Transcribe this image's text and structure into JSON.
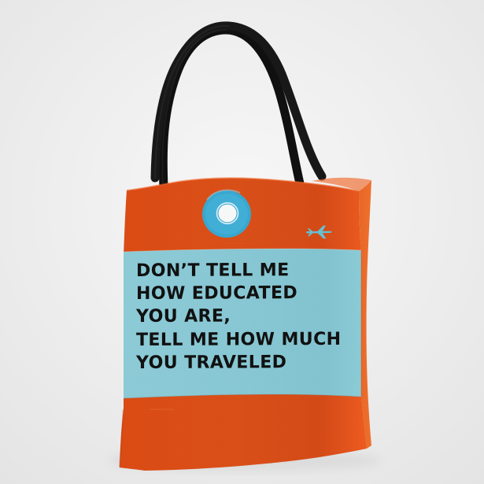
{
  "product": {
    "quote_lines": [
      "DON’T TELL ME",
      "HOW EDUCATED",
      "YOU ARE,",
      "TELL ME HOW MUCH",
      "YOU TRAVELED"
    ]
  },
  "colors": {
    "bag_orange": "#dc4f17",
    "panel_blue": "#86c7d4",
    "ring_blue": "#38a9d0",
    "handle_black": "#111111",
    "text_black": "#111111",
    "background": "#ececec"
  },
  "icons": {
    "ring": "round-ring-icon",
    "plane": "airplane-icon"
  }
}
